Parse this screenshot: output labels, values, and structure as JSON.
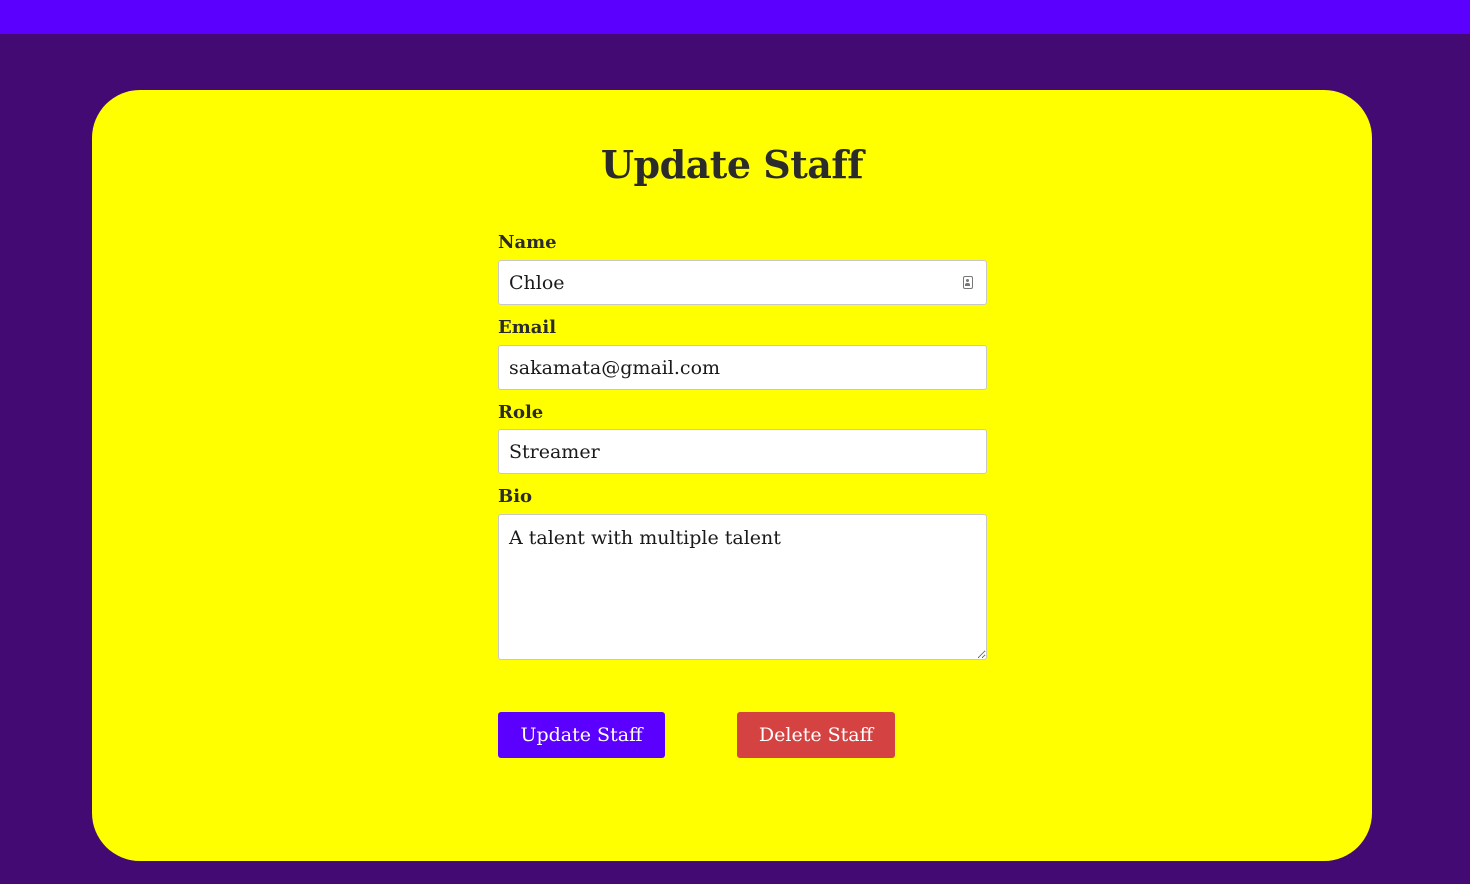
{
  "page": {
    "title": "Update Staff"
  },
  "form": {
    "name": {
      "label": "Name",
      "value": "Chloe"
    },
    "email": {
      "label": "Email",
      "value": "sakamata@gmail.com"
    },
    "role": {
      "label": "Role",
      "value": "Streamer"
    },
    "bio": {
      "label": "Bio",
      "value": "A talent with multiple talent"
    }
  },
  "actions": {
    "update_label": "Update Staff",
    "delete_label": "Delete Staff"
  },
  "colors": {
    "background": "#420a72",
    "topbar": "#5b00ff",
    "card": "#ffff00",
    "update_button": "#5b00ff",
    "delete_button": "#d44242"
  },
  "icons": {
    "name_field_icon": "contact-card-icon"
  }
}
